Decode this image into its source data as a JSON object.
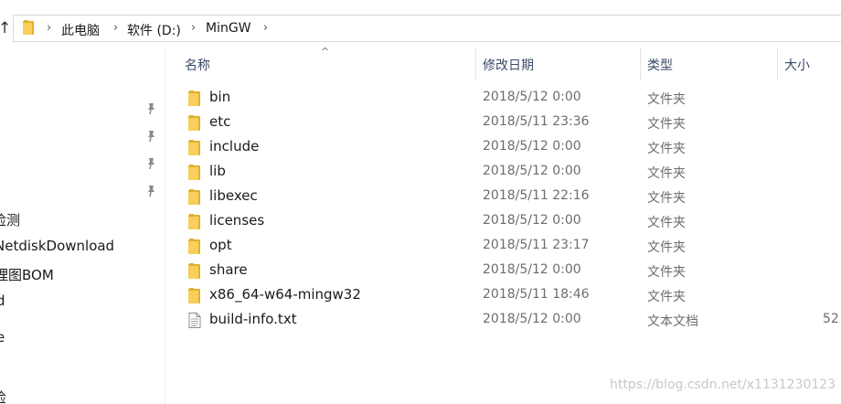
{
  "address": {
    "crumbs": [
      "此电脑",
      "软件 (D:)",
      "MinGW"
    ]
  },
  "nav": {
    "items": [
      "检测",
      "NetdiskDownload",
      "理图BOM",
      "d",
      "e",
      "检"
    ]
  },
  "columns": {
    "name": "名称",
    "date": "修改日期",
    "type": "类型",
    "size": "大小"
  },
  "files": [
    {
      "name": "bin",
      "date": "2018/5/12 0:00",
      "type": "文件夹",
      "size": "",
      "icon": "folder-icon"
    },
    {
      "name": "etc",
      "date": "2018/5/11 23:36",
      "type": "文件夹",
      "size": "",
      "icon": "folder-icon"
    },
    {
      "name": "include",
      "date": "2018/5/12 0:00",
      "type": "文件夹",
      "size": "",
      "icon": "folder-icon"
    },
    {
      "name": "lib",
      "date": "2018/5/12 0:00",
      "type": "文件夹",
      "size": "",
      "icon": "folder-icon"
    },
    {
      "name": "libexec",
      "date": "2018/5/11 22:16",
      "type": "文件夹",
      "size": "",
      "icon": "folder-icon"
    },
    {
      "name": "licenses",
      "date": "2018/5/12 0:00",
      "type": "文件夹",
      "size": "",
      "icon": "folder-icon"
    },
    {
      "name": "opt",
      "date": "2018/5/11 23:17",
      "type": "文件夹",
      "size": "",
      "icon": "folder-icon"
    },
    {
      "name": "share",
      "date": "2018/5/12 0:00",
      "type": "文件夹",
      "size": "",
      "icon": "folder-icon"
    },
    {
      "name": "x86_64-w64-mingw32",
      "date": "2018/5/11 18:46",
      "type": "文件夹",
      "size": "",
      "icon": "folder-icon"
    },
    {
      "name": "build-info.txt",
      "date": "2018/5/12 0:00",
      "type": "文本文档",
      "size": "52",
      "icon": "text-file-icon"
    }
  ],
  "watermark": "https://blog.csdn.net/x1131230123",
  "colors": {
    "folder": "#f7cf5a",
    "folder_dark": "#e0b030",
    "header_text": "#3a4a6a",
    "meta_text": "#6d6d6d"
  }
}
